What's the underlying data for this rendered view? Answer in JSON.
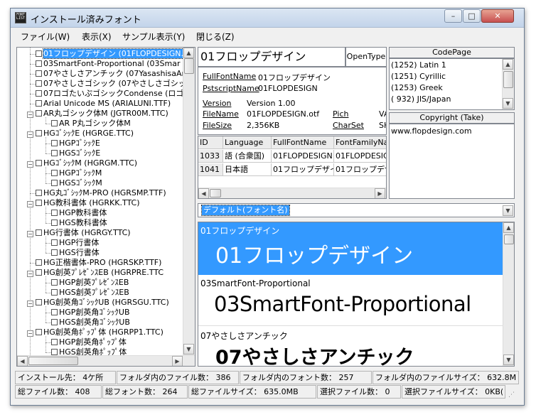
{
  "window": {
    "title": "インストール済みフォント",
    "icon_text": "FONT LIST"
  },
  "menu": [
    {
      "label": "ファイル(W)"
    },
    {
      "label": "表示(X)"
    },
    {
      "label": "サンプル表示(Y)"
    },
    {
      "label": "閉じる(Z)"
    }
  ],
  "tree": [
    {
      "label": "01フロップデザイン (01FLOPDESIGN.)",
      "depth": 1,
      "selected": true
    },
    {
      "label": "03SmartFont-Proportional (03Smar",
      "depth": 1
    },
    {
      "label": "07やさしさアンチック (07YasashisaAnt",
      "depth": 1
    },
    {
      "label": "07やさしさゴシック (07やさしさゴシック",
      "depth": 1
    },
    {
      "label": "07ロゴたいぷゴシックCondense (ロゴた",
      "depth": 1
    },
    {
      "label": "Arial Unicode MS (ARIALUNI.TTF)",
      "depth": 1
    },
    {
      "label": "AR丸ゴシック体M (JGTR00M.TTC)",
      "depth": 1,
      "expander": true
    },
    {
      "label": "AR P丸ゴシック体M",
      "depth": 2
    },
    {
      "label": "HGｺﾞｼｯｸE (HGRGE.TTC)",
      "depth": 1,
      "expander": true
    },
    {
      "label": "HGPｺﾞｼｯｸE",
      "depth": 2
    },
    {
      "label": "HGSｺﾞｼｯｸE",
      "depth": 2
    },
    {
      "label": "HGｺﾞｼｯｸM (HGRGM.TTC)",
      "depth": 1,
      "expander": true
    },
    {
      "label": "HGPｺﾞｼｯｸM",
      "depth": 2
    },
    {
      "label": "HGSｺﾞｼｯｸM",
      "depth": 2
    },
    {
      "label": "HG丸ｺﾞｼｯｸM-PRO (HGRSMP.TTF)",
      "depth": 1
    },
    {
      "label": "HG教科書体 (HGRKK.TTC)",
      "depth": 1,
      "expander": true
    },
    {
      "label": "HGP教科書体",
      "depth": 2
    },
    {
      "label": "HGS教科書体",
      "depth": 2
    },
    {
      "label": "HG行書体 (HGRGY.TTC)",
      "depth": 1,
      "expander": true
    },
    {
      "label": "HGP行書体",
      "depth": 2
    },
    {
      "label": "HGS行書体",
      "depth": 2
    },
    {
      "label": "HG正楷書体-PRO (HGRSKP.TTF)",
      "depth": 1
    },
    {
      "label": "HG創英ﾌﾟﾚｾﾞﾝｽEB (HGRPRE.TTC",
      "depth": 1,
      "expander": true
    },
    {
      "label": "HGP創英ﾌﾟﾚｾﾞﾝｽEB",
      "depth": 2
    },
    {
      "label": "HGS創英ﾌﾟﾚｾﾞﾝｽEB",
      "depth": 2
    },
    {
      "label": "HG創英角ｺﾞｼｯｸUB (HGRSGU.TTC)",
      "depth": 1,
      "expander": true
    },
    {
      "label": "HGP創英角ｺﾞｼｯｸUB",
      "depth": 2
    },
    {
      "label": "HGS創英角ｺﾞｼｯｸUB",
      "depth": 2
    },
    {
      "label": "HG創英角ﾎﾟｯﾌﾟ体 (HGRPP1.TTC)",
      "depth": 1,
      "expander": true
    },
    {
      "label": "HGP創英角ﾎﾟｯﾌﾟ体",
      "depth": 2
    },
    {
      "label": "HGS創英角ﾎﾟｯﾌﾟ体",
      "depth": 2
    }
  ],
  "selected_font": {
    "name": "01フロップデザイン",
    "type": "OpenType"
  },
  "info": {
    "full_font_name_label": "FullFontName",
    "full_font_name": "01フロップデザイン",
    "postscript_label": "PstscriptName",
    "postscript": "01FLOPDESIGN",
    "version_label": "Version",
    "version": "Version 1.00",
    "filename_label": "FileName",
    "filename": "01FLOPDESIGN.otf",
    "filesize_label": "FileSize",
    "filesize": "2,356KB",
    "pich_label": "Pich",
    "pich": "VA",
    "charset_label": "CharSet",
    "charset": "SH"
  },
  "name_table": {
    "headers": [
      "ID",
      "Language",
      "FullFontName",
      "FontFamilyNa"
    ],
    "rows": [
      [
        "1033",
        "語 (合衆国)",
        "01FLOPDESIGN",
        "01FLOPDESIG"
      ],
      [
        "1041",
        "日本語",
        "01フロップデザイン",
        "01フロップデザ"
      ]
    ]
  },
  "codepage": {
    "header": "CodePage",
    "items": [
      "(1252) Latin 1",
      "(1251) Cyrillic",
      "(1253) Greek",
      "( 932) JIS/Japan"
    ]
  },
  "copyright": {
    "header": "Copyright (Take)",
    "text": "www.flopdesign.com"
  },
  "sample_combo": {
    "value": "デフォルト(フォント名)"
  },
  "preview": [
    {
      "label": "01フロップデザイン",
      "sample": "01フロップデザイン",
      "selected": true
    },
    {
      "label": "03SmartFont-Proportional",
      "sample": "03SmartFont-Proportional"
    },
    {
      "label": "07やさしさアンチック",
      "sample": "07やさしさアンチック"
    }
  ],
  "status": {
    "install_dest": "インストール先： 4ケ所",
    "files_in_folder": "フォルダ内のファイル数： 386",
    "fonts_in_folder": "フォルダ内のフォント数： 257",
    "folder_file_size": "フォルダ内のファイルサイズ： 632.8M",
    "total_files": "総ファイル数： 408",
    "total_fonts": "総フォント数： 264",
    "total_file_size": "総ファイルサイズ： 635.0MB",
    "selected_files": "選択ファイル数： 0",
    "selected_file_size": "選択ファイルサイズ： 0KB("
  },
  "colors": {
    "selection": "#3399ff",
    "title_bg": "#dbe6f3",
    "close": "#c75050"
  }
}
